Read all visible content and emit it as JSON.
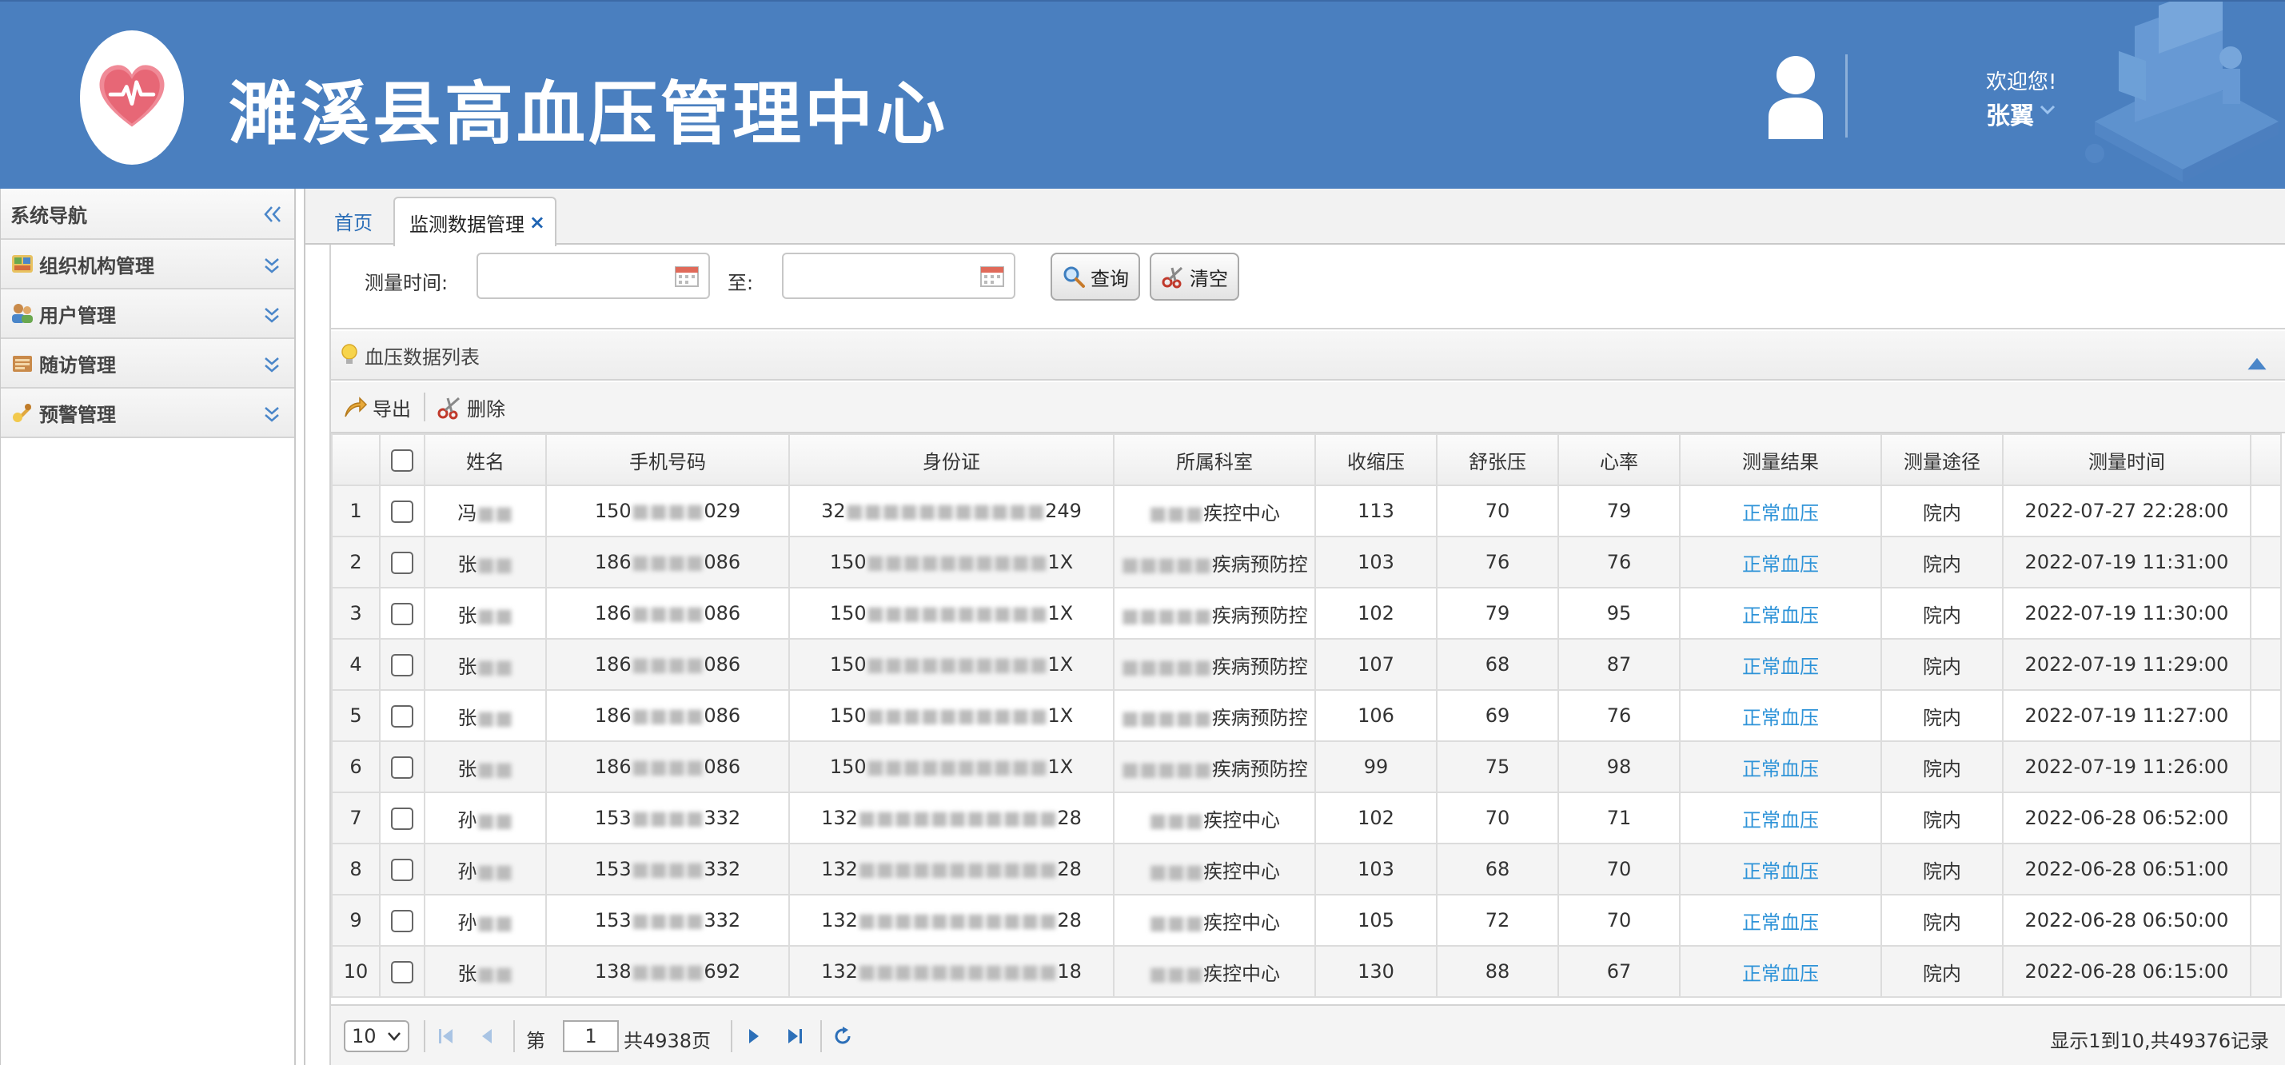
{
  "header": {
    "title": "濉溪县高血压管理中心",
    "welcome": "欢迎您!",
    "username": "张翼"
  },
  "sidebar": {
    "title": "系统导航",
    "items": [
      {
        "label": "组织机构管理",
        "icon": "org-icon"
      },
      {
        "label": "用户管理",
        "icon": "users-icon"
      },
      {
        "label": "随访管理",
        "icon": "followup-icon"
      },
      {
        "label": "预警管理",
        "icon": "alert-icon"
      }
    ]
  },
  "tabs": {
    "home": "首页",
    "active": "监测数据管理",
    "close": "×"
  },
  "search": {
    "time_label": "测量时间:",
    "to_label": "至:",
    "query_label": "查询",
    "clear_label": "清空"
  },
  "list": {
    "title": "血压数据列表",
    "export_label": "导出",
    "delete_label": "删除",
    "columns": [
      "姓名",
      "手机号码",
      "身份证",
      "所属科室",
      "收缩压",
      "舒张压",
      "心率",
      "测量结果",
      "测量途径",
      "测量时间"
    ],
    "rows": [
      {
        "no": "1",
        "name": "冯",
        "name_blur": "■■",
        "phone_a": "150",
        "phone_blur": "■■■■",
        "phone_b": "029",
        "id_a": "32",
        "id_blur": "■■■■■■■■■■■",
        "id_b": "249",
        "dept_blur": "■■■",
        "dept": "疾控中心",
        "sys": "113",
        "dia": "70",
        "hr": "79",
        "result": "正常血压",
        "route": "院内",
        "time": "2022-07-27 22:28:00"
      },
      {
        "no": "2",
        "name": "张",
        "name_blur": "■■",
        "phone_a": "186",
        "phone_blur": "■■■■",
        "phone_b": "086",
        "id_a": "150",
        "id_blur": "■■■■■■■■■■",
        "id_b": "1X",
        "dept_blur": "■■■■■",
        "dept": "疾病预防控",
        "sys": "103",
        "dia": "76",
        "hr": "76",
        "result": "正常血压",
        "route": "院内",
        "time": "2022-07-19 11:31:00"
      },
      {
        "no": "3",
        "name": "张",
        "name_blur": "■■",
        "phone_a": "186",
        "phone_blur": "■■■■",
        "phone_b": "086",
        "id_a": "150",
        "id_blur": "■■■■■■■■■■",
        "id_b": "1X",
        "dept_blur": "■■■■■",
        "dept": "疾病预防控",
        "sys": "102",
        "dia": "79",
        "hr": "95",
        "result": "正常血压",
        "route": "院内",
        "time": "2022-07-19 11:30:00"
      },
      {
        "no": "4",
        "name": "张",
        "name_blur": "■■",
        "phone_a": "186",
        "phone_blur": "■■■■",
        "phone_b": "086",
        "id_a": "150",
        "id_blur": "■■■■■■■■■■",
        "id_b": "1X",
        "dept_blur": "■■■■■",
        "dept": "疾病预防控",
        "sys": "107",
        "dia": "68",
        "hr": "87",
        "result": "正常血压",
        "route": "院内",
        "time": "2022-07-19 11:29:00"
      },
      {
        "no": "5",
        "name": "张",
        "name_blur": "■■",
        "phone_a": "186",
        "phone_blur": "■■■■",
        "phone_b": "086",
        "id_a": "150",
        "id_blur": "■■■■■■■■■■",
        "id_b": "1X",
        "dept_blur": "■■■■■",
        "dept": "疾病预防控",
        "sys": "106",
        "dia": "69",
        "hr": "76",
        "result": "正常血压",
        "route": "院内",
        "time": "2022-07-19 11:27:00"
      },
      {
        "no": "6",
        "name": "张",
        "name_blur": "■■",
        "phone_a": "186",
        "phone_blur": "■■■■",
        "phone_b": "086",
        "id_a": "150",
        "id_blur": "■■■■■■■■■■",
        "id_b": "1X",
        "dept_blur": "■■■■■",
        "dept": "疾病预防控",
        "sys": "99",
        "dia": "75",
        "hr": "98",
        "result": "正常血压",
        "route": "院内",
        "time": "2022-07-19 11:26:00"
      },
      {
        "no": "7",
        "name": "孙",
        "name_blur": "■■",
        "phone_a": "153",
        "phone_blur": "■■■■",
        "phone_b": "332",
        "id_a": "132",
        "id_blur": "■■■■■■■■■■■",
        "id_b": "28",
        "dept_blur": "■■■",
        "dept": "疾控中心",
        "sys": "102",
        "dia": "70",
        "hr": "71",
        "result": "正常血压",
        "route": "院内",
        "time": "2022-06-28 06:52:00"
      },
      {
        "no": "8",
        "name": "孙",
        "name_blur": "■■",
        "phone_a": "153",
        "phone_blur": "■■■■",
        "phone_b": "332",
        "id_a": "132",
        "id_blur": "■■■■■■■■■■■",
        "id_b": "28",
        "dept_blur": "■■■",
        "dept": "疾控中心",
        "sys": "103",
        "dia": "68",
        "hr": "70",
        "result": "正常血压",
        "route": "院内",
        "time": "2022-06-28 06:51:00"
      },
      {
        "no": "9",
        "name": "孙",
        "name_blur": "■■",
        "phone_a": "153",
        "phone_blur": "■■■■",
        "phone_b": "332",
        "id_a": "132",
        "id_blur": "■■■■■■■■■■■",
        "id_b": "28",
        "dept_blur": "■■■",
        "dept": "疾控中心",
        "sys": "105",
        "dia": "72",
        "hr": "70",
        "result": "正常血压",
        "route": "院内",
        "time": "2022-06-28 06:50:00"
      },
      {
        "no": "10",
        "name": "张",
        "name_blur": "■■",
        "phone_a": "138",
        "phone_blur": "■■■■",
        "phone_b": "692",
        "id_a": "132",
        "id_blur": "■■■■■■■■■■■",
        "id_b": "18",
        "dept_blur": "■■■",
        "dept": "疾控中心",
        "sys": "130",
        "dia": "88",
        "hr": "67",
        "result": "正常血压",
        "route": "院内",
        "time": "2022-06-28 06:15:00"
      }
    ]
  },
  "pager": {
    "page_size": "10",
    "page_prefix": "第",
    "page_current": "1",
    "page_total": "共4938页",
    "info": "显示1到10,共49376记录"
  },
  "colors": {
    "header_bg": "#4a7fbf",
    "link_blue": "#2e93d8",
    "pager_icon": "#2c6fb8"
  }
}
